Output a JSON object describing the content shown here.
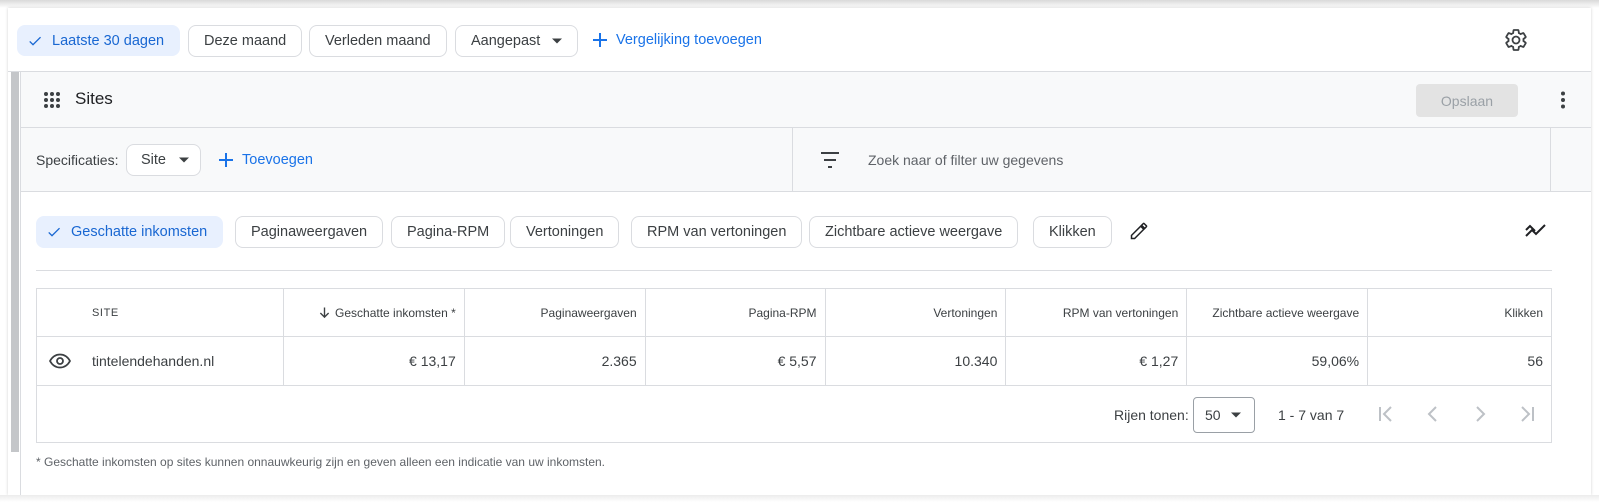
{
  "date_range": {
    "selected": "Laatste 30 dagen",
    "options": [
      "Deze maand",
      "Verleden maand"
    ],
    "custom": "Aangepast",
    "add_comparison": "Vergelijking toevoegen"
  },
  "card": {
    "title": "Sites",
    "save_label": "Opslaan"
  },
  "dimensions": {
    "label": "Specificaties:",
    "selected": "Site",
    "add_label": "Toevoegen"
  },
  "filter": {
    "placeholder": "Zoek naar of filter uw gegevens"
  },
  "metrics": {
    "selected": "Geschatte inkomsten",
    "chips": [
      "Paginaweergaven",
      "Pagina-RPM",
      "Vertoningen",
      "RPM van vertoningen",
      "Zichtbare actieve weergave",
      "Klikken"
    ]
  },
  "table": {
    "headers": [
      "SITE",
      "Geschatte inkomsten *",
      "Paginaweergaven",
      "Pagina-RPM",
      "Vertoningen",
      "RPM van vertoningen",
      "Zichtbare actieve weergave",
      "Klikken"
    ],
    "rows": [
      [
        "tintelendehanden.nl",
        "€ 13,17",
        "2.365",
        "€ 5,57",
        "10.340",
        "€ 1,27",
        "59,06%",
        "56"
      ]
    ]
  },
  "pagination": {
    "rows_label": "Rijen tonen:",
    "rows_value": "50",
    "range": "1 - 7 van 7"
  },
  "footnote": "* Geschatte inkomsten op sites kunnen onnauwkeurig zijn en geven alleen een indicatie van uw inkomsten.",
  "colors": {
    "accent": "#1a73e8",
    "selected_chip_bg": "#e8f0fe",
    "border": "#dadce0"
  }
}
